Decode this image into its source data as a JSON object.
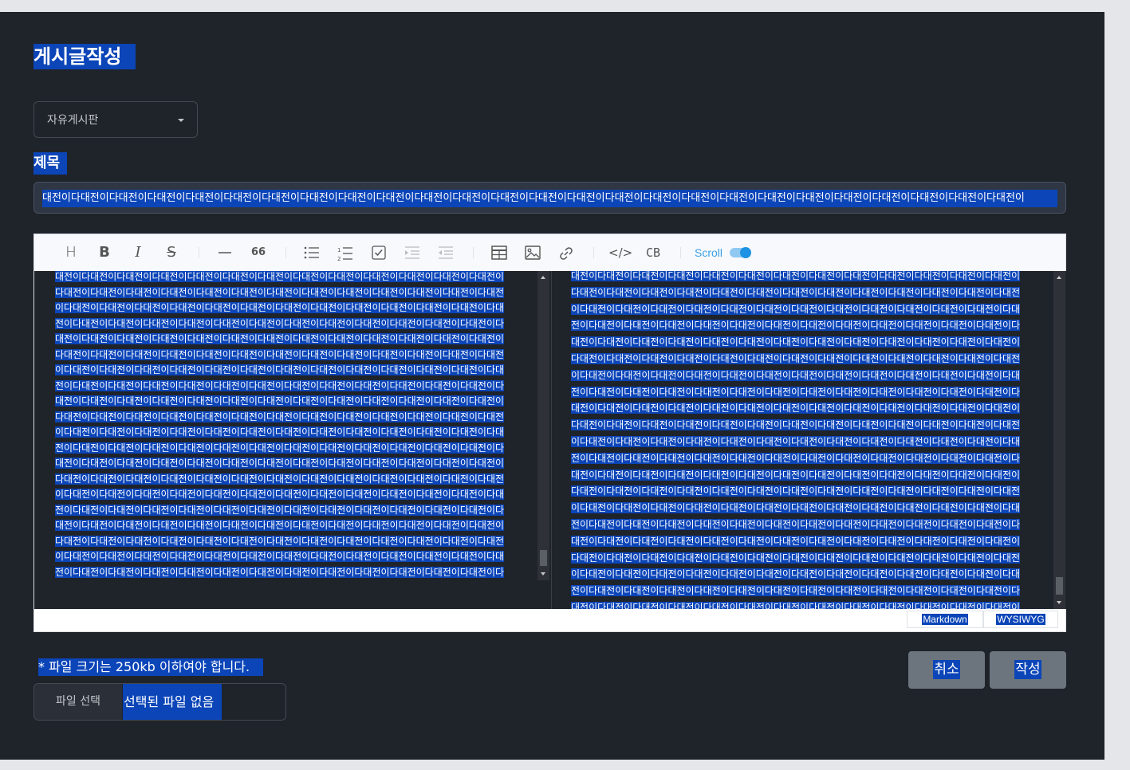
{
  "page": {
    "title": "게시글작성"
  },
  "board_select": {
    "value": "자유게시판"
  },
  "subject": {
    "label": "제목",
    "value": "대전이다대전이다대전이다대전이다대전이다대전이다대전이다대전이다대전이다대전이다대전이다대전이다대전이다대전이다대전이다대전이다대전이다대전이다대전이다대전이다대전이다대전이다대전이다대전이다대전이다대전이"
  },
  "editor": {
    "toolbar": {
      "items": [
        {
          "name": "heading-icon",
          "glyph": "H"
        },
        {
          "name": "bold-icon",
          "glyph": "B"
        },
        {
          "name": "italic-icon",
          "glyph": "I"
        },
        {
          "name": "strike-icon",
          "glyph": "S"
        },
        {
          "name": "hr-icon",
          "glyph": "—"
        },
        {
          "name": "quote-icon",
          "glyph": "66"
        },
        {
          "name": "bullet-list-icon",
          "glyph": ""
        },
        {
          "name": "ordered-list-icon",
          "glyph": ""
        },
        {
          "name": "task-list-icon",
          "glyph": ""
        },
        {
          "name": "indent-icon",
          "glyph": ""
        },
        {
          "name": "outdent-icon",
          "glyph": ""
        },
        {
          "name": "table-icon",
          "glyph": ""
        },
        {
          "name": "image-icon",
          "glyph": ""
        },
        {
          "name": "link-icon",
          "glyph": ""
        },
        {
          "name": "code-icon",
          "glyph": "</>"
        },
        {
          "name": "codeblock-icon",
          "glyph": "CB"
        }
      ],
      "scroll_label": "Scroll",
      "scroll_sync_on": true
    },
    "markdown_text": "대전이다대전이다대전이다대전이다대전이다대전이다대전이다대전이다대전이다대전이다대전이다대전이다대전이다대전이다대전이다대전이다대전이다대전이다대전이다대전이다대전이다대전이다대전이다대전이다대전이다대전이다대전이다대전이다대전이다대전이다대전이다대전이다대전이다대전이다대전이다대전이다대전이다대전이다대전이다대전이다대전이다대전이다대전이다대전이다대전이다대전이다대전이다대전이다대전이다대전이다대전이다대전이다대전이다대전이다대전이다대전이다대전이다대전이다대전이다대전이다대전이다대전이다대전이다대전이다대전이다대전이다대전이다대전이다대전이다대전이다대전이다대전이다대전이다대전이다대전이다대전이다대전이다대전이다대전이다대전이다대전이다대전이다대전이다대전이다대전이다대전이다대전이다대전이다대전이다대전이다대전이다대전이다대전이다대전이다대전이다대전이다대전이다대전이다대전이다대전이다대전이다대전이다대전이다대전이다대전이다대전이다대전이다대전이다대전이다대전이다대전이다대전이다대전이다대전이다대전이다대전이다대전이다대전이다대전이다대전이다대전이다대전이다대전이다대전이다대전이다대전이다대전이다대전이다대전이다대전이다대전이다대전이다대전이다대전이다대전이다대전이다대전이다대전이다대전이다대전이다대전이다대전이다대전이다대전이다대전이다대전이다대전이다대전이다대전이다대전이다대전이다대전이다대전이다대전이다대전이다대전이다대전이다대전이다대전이다대전이다대전이다대전이다대전이다대전이다대전이다대전이다대전이다대전이다대전이다대전이다대전이다대전이다대전이다대전이다대전이다대전이다대전이다대전이다대전이다대전이다대전이다대전이다대전이다대전이다대전이다대전이다대전이다대전이다대전이다대전이다대전이다대전이다대전이다대전이다대전이다대전이다대전이다대전이다대전이다대전이다대전이다대전이다대전이다대전이다대전이다대전이다대전이다대전이다대전이다대전이다대전이다대전이다대전이다대전이다대전이다대전이다대전이다대전이다대전이다대전이다대전이다대전이다대전이다대전이다대전이다대전이다대전이다대전이다대전이다대전이다대전이다대전이다대전이다대전이다대전이다대전이다대전이다대전이다대전이다대전이다대전이다대전이다대전이다대전이다대전이다대전이다대전이다대전이다대전이다대전이다대전이다대전이다대전이다대전이다대전이다대전이다대전이다대전이다대전이다대전이다대전이다대전이다대전이다대전이다대전이다대전이다대전이다대전이다대전이다대전이다대전이다대전이다대전이다대전이다대전이다대전이다대전이다대전이다대전이다대전이다대전이다",
    "preview_text": "대전이다대전이다대전이다대전이다대전이다대전이다대전이다대전이다대전이다대전이다대전이다대전이다대전이다대전이다대전이다대전이다대전이다대전이다대전이다대전이다대전이다대전이다대전이다대전이다대전이다대전이다대전이다대전이다대전이다대전이다대전이다대전이다대전이다대전이다대전이다대전이다대전이다대전이다대전이다대전이다대전이다대전이다대전이다대전이다대전이다대전이다대전이다대전이다대전이다대전이다대전이다대전이다대전이다대전이다대전이다대전이다대전이다대전이다대전이다대전이다대전이다대전이다대전이다대전이다대전이다대전이다대전이다대전이다대전이다대전이다대전이다대전이다대전이다대전이다대전이다대전이다대전이다대전이다대전이다대전이다대전이다대전이다대전이다대전이다대전이다대전이다대전이다대전이다대전이다대전이다대전이다대전이다대전이다대전이다대전이다대전이다대전이다대전이다대전이다대전이다대전이다대전이다대전이다대전이다대전이다대전이다대전이다대전이다대전이다대전이다대전이다대전이다대전이다대전이다대전이다대전이다대전이다대전이다대전이다대전이다대전이다대전이다대전이다대전이다대전이다대전이다대전이다대전이다대전이다대전이다대전이다대전이다대전이다대전이다대전이다대전이다대전이다대전이다대전이다대전이다대전이다대전이다대전이다대전이다대전이다대전이다대전이다대전이다대전이다대전이다대전이다대전이다대전이다대전이다대전이다대전이다대전이다대전이다대전이다대전이다대전이다대전이다대전이다대전이다대전이다대전이다대전이다대전이다대전이다대전이다대전이다대전이다대전이다대전이다대전이다대전이다대전이다대전이다대전이다대전이다대전이다대전이다대전이다대전이다대전이다대전이다대전이다대전이다대전이다대전이다대전이다대전이다대전이다대전이다대전이다대전이다대전이다대전이다대전이다대전이다대전이다대전이다대전이다대전이다대전이다대전이다대전이다대전이다대전이다대전이다대전이다대전이다대전이다대전이다대전이다대전이다대전이다대전이다대전이다대전이다대전이다대전이다대전이다대전이다대전이다대전이다대전이다대전이다대전이다대전이다대전이다대전이다대전이다대전이다대전이다대전이다대전이다대전이다대전이다대전이다대전이다대전이다대전이다대전이다대전이다대전이다대전이다대전이다대전이다대전이다대전이다대전이다대전이다대전이다대전이다대전이다대전이다대전이다대전이다대전이다대전이다대전이다대전이다대전이다대전이다대전이다대전이다대전이다대전이다대전이다대전이다대전이다대전이다대전이다대전이다대전이다대전이다대전이다대전이다대전이다대전이다대전이다대전이다대전이다대전이다대전이다대전이다대전이다대전이다대전이다대전이다대전이다대전이다대전이다",
    "mode_tabs": [
      "Markdown",
      "WYSIWYG"
    ]
  },
  "file": {
    "note": "* 파일 크기는 250kb 이하여야 합니다.",
    "button_label": "파일 선택",
    "status": "선택된 파일 없음"
  },
  "actions": {
    "cancel": "취소",
    "submit": "작성"
  },
  "colors": {
    "background": "#1f232a",
    "selection": "#0b45b8",
    "button": "#6c757d",
    "accent": "#1e93e3"
  }
}
